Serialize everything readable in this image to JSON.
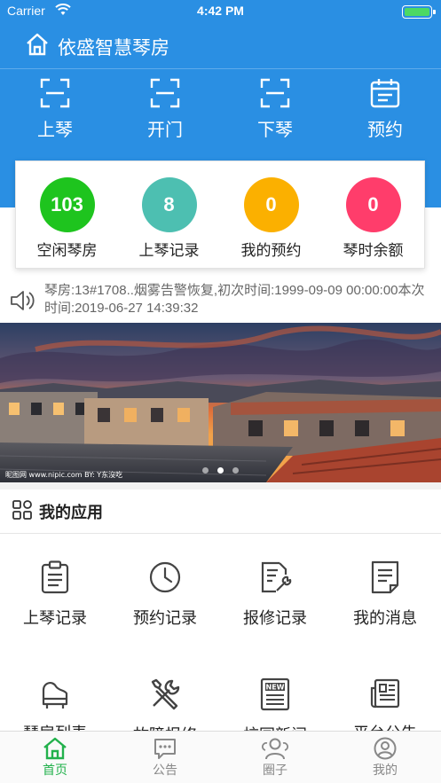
{
  "status_bar": {
    "carrier": "Carrier",
    "time": "4:42 PM"
  },
  "header": {
    "title": "依盛智慧琴房"
  },
  "quick_actions": [
    {
      "label": "上琴",
      "icon": "scan-icon"
    },
    {
      "label": "开门",
      "icon": "scan-icon"
    },
    {
      "label": "下琴",
      "icon": "scan-icon"
    },
    {
      "label": "预约",
      "icon": "calendar-icon"
    }
  ],
  "stats": [
    {
      "value": "103",
      "label": "空闲琴房",
      "color": "#1ec41e"
    },
    {
      "value": "8",
      "label": "上琴记录",
      "color": "#4dbfb1"
    },
    {
      "value": "0",
      "label": "我的预约",
      "color": "#fbb000"
    },
    {
      "value": "0",
      "label": "琴时余额",
      "color": "#ff3d6b"
    }
  ],
  "notice": {
    "text": "琴房:13#1708..烟雾告警恢复,初次时间:1999-09-09 00:00:00本次时间:2019-06-27 14:39:32"
  },
  "banner": {
    "watermark_left": "昵图网 www.nipic.com   BY: Y东沒吃",
    "active_slide": 2,
    "slide_count": 3
  },
  "my_apps": {
    "title": "我的应用",
    "items": [
      {
        "label": "上琴记录",
        "icon": "clipboard-icon"
      },
      {
        "label": "预约记录",
        "icon": "clock-icon"
      },
      {
        "label": "报修记录",
        "icon": "wrench-document-icon"
      },
      {
        "label": "我的消息",
        "icon": "message-document-icon"
      },
      {
        "label": "琴房列表",
        "icon": "piano-icon"
      },
      {
        "label": "故障报修",
        "icon": "tools-icon"
      },
      {
        "label": "校园新闻",
        "icon": "newspaper-icon"
      },
      {
        "label": "平台公告",
        "icon": "announcement-icon"
      }
    ]
  },
  "tabbar": {
    "items": [
      {
        "label": "首页",
        "icon": "home-icon",
        "active": true
      },
      {
        "label": "公告",
        "icon": "chat-icon",
        "active": false
      },
      {
        "label": "圈子",
        "icon": "group-icon",
        "active": false
      },
      {
        "label": "我的",
        "icon": "profile-icon",
        "active": false
      }
    ],
    "active_color": "#22b14c"
  },
  "colors": {
    "primary": "#2a8fe3"
  }
}
